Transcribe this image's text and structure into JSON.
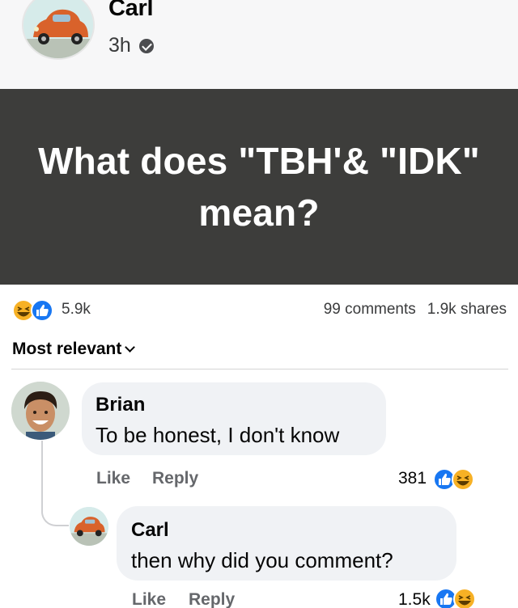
{
  "post": {
    "author": "Carl",
    "time": "3h",
    "text": "What does \"TBH'& \"IDK\" mean?",
    "card_color": "#3d3d3b"
  },
  "engagement": {
    "reactions": "5.9k",
    "comments": "99 comments",
    "shares": "1.9k shares"
  },
  "sort": {
    "label": "Most relevant"
  },
  "comments": [
    {
      "author": "Brian",
      "text": "To be honest, I don't know",
      "like_label": "Like",
      "reply_label": "Reply",
      "reaction_count": "381"
    },
    {
      "author": "Carl",
      "text": "then why did you comment?",
      "like_label": "Like",
      "reply_label": "Reply",
      "reaction_count": "1.5k"
    }
  ],
  "icons": {
    "audience": "public-audience-icon",
    "reactions": [
      "haha-reaction-icon",
      "like-reaction-icon"
    ],
    "sort_chevron": "chevron-down-icon"
  },
  "colors": {
    "like_blue": "#1877f2",
    "haha_yellow": "#f7b125",
    "muted_text": "#65676b",
    "bubble_bg": "#f0f2f5"
  }
}
